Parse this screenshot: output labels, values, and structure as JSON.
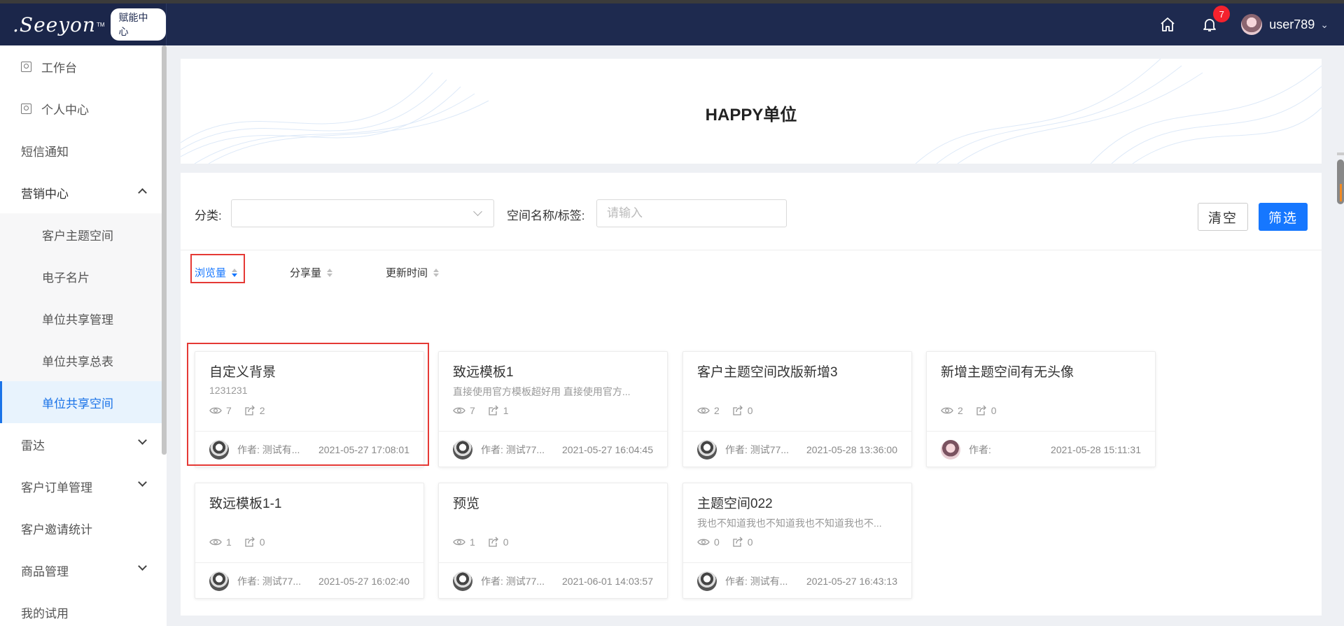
{
  "header": {
    "logo_text": ".Seeyon",
    "logo_tm": "TM",
    "logo_badge": "赋能中心",
    "notification_count": "7",
    "username": "user789"
  },
  "sidebar": {
    "items": [
      {
        "label": "工作台"
      },
      {
        "label": "个人中心"
      },
      {
        "label": "短信通知"
      },
      {
        "label": "营销中心"
      },
      {
        "label": "客户主题空间"
      },
      {
        "label": "电子名片"
      },
      {
        "label": "单位共享管理"
      },
      {
        "label": "单位共享总表"
      },
      {
        "label": "单位共享空间"
      },
      {
        "label": "雷达"
      },
      {
        "label": "客户订单管理"
      },
      {
        "label": "客户邀请统计"
      },
      {
        "label": "商品管理"
      },
      {
        "label": "我的试用"
      }
    ]
  },
  "banner": {
    "title": "HAPPY单位"
  },
  "filters": {
    "category_label": "分类:",
    "name_label": "空间名称/标签:",
    "name_placeholder": "请输入",
    "clear_label": "清空",
    "filter_label": "筛选"
  },
  "sort": {
    "views": "浏览量",
    "shares": "分享量",
    "updated": "更新时间"
  },
  "cards": [
    {
      "title": "自定义背景",
      "desc": "1231231",
      "views": "7",
      "shares": "2",
      "author": "作者: 测试有...",
      "date": "2021-05-27 17:08:01"
    },
    {
      "title": "致远模板1",
      "desc": "直接使用官方模板超好用 直接使用官方...",
      "views": "7",
      "shares": "1",
      "author": "作者: 测试77...",
      "date": "2021-05-27 16:04:45"
    },
    {
      "title": "客户主题空间改版新增3",
      "desc": "",
      "views": "2",
      "shares": "0",
      "author": "作者: 测试77...",
      "date": "2021-05-28 13:36:00"
    },
    {
      "title": "新增主题空间有无头像",
      "desc": "",
      "views": "2",
      "shares": "0",
      "author": "作者:",
      "date": "2021-05-28 15:11:31"
    },
    {
      "title": "致远模板1-1",
      "desc": "",
      "views": "1",
      "shares": "0",
      "author": "作者: 测试77...",
      "date": "2021-05-27 16:02:40"
    },
    {
      "title": "预览",
      "desc": "",
      "views": "1",
      "shares": "0",
      "author": "作者: 测试77...",
      "date": "2021-06-01 14:03:57"
    },
    {
      "title": "主题空间022",
      "desc": "我也不知道我也不知道我也不知道我也不...",
      "views": "0",
      "shares": "0",
      "author": "作者: 测试有...",
      "date": "2021-05-27 16:43:13"
    }
  ],
  "colors": {
    "header_bg": "#1e2a4f",
    "primary": "#1677ff",
    "highlight_red": "#e53935",
    "badge_red": "#f5222d"
  }
}
